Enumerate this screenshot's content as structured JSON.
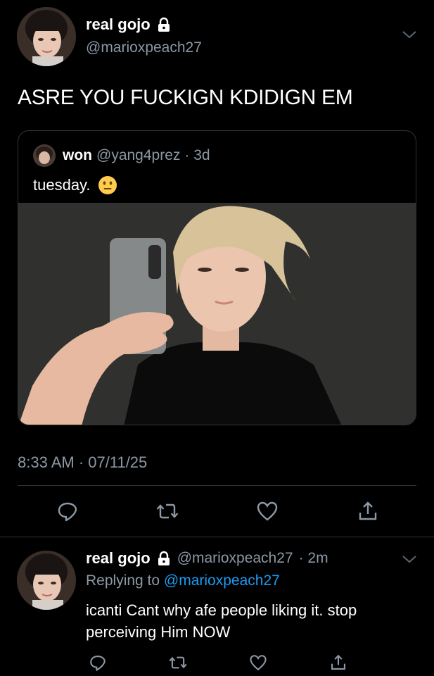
{
  "main_tweet": {
    "display_name": "real gojo",
    "handle": "@marioxpeach27",
    "text": "ASRE YOU FUCKIGN KDIDIGN EM",
    "timestamp": "8:33 AM · 07/11/25",
    "locked_icon": "lock-icon",
    "menu_icon": "chevron-down-icon"
  },
  "quoted_tweet": {
    "display_name": "won",
    "handle": "@yang4prez",
    "age": "· 3d",
    "text": "tuesday.",
    "emoji": "neutral-face-emoji"
  },
  "actions": [
    "reply-icon",
    "retweet-icon",
    "like-icon",
    "share-icon"
  ],
  "reply": {
    "display_name": "real gojo",
    "handle": "@marioxpeach27",
    "age": "· 2m",
    "replying_prefix": "Replying to",
    "replying_to": "@marioxpeach27",
    "text": "icanti Cant why afe people liking it. stop perceiving Him NOW"
  },
  "colors": {
    "background": "#000000",
    "secondary_text": "#8b98a5",
    "link": "#1d9bf0",
    "divider": "#2f3336"
  }
}
